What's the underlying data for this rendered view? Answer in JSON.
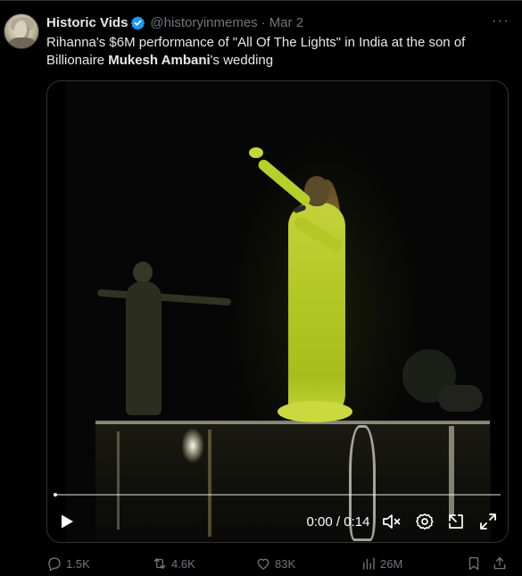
{
  "tweet": {
    "display_name": "Historic Vids",
    "handle": "@historyinmemes",
    "separator": "·",
    "date": "Mar 2",
    "more_label": "···",
    "text_before": "Rihanna's $6M performance of \"All Of The Lights\" in India at the son of Billionaire ",
    "text_bold": "Mukesh Ambani",
    "text_after": "'s wedding"
  },
  "video": {
    "time_display": "0:00 / 0:14",
    "progress": 0,
    "icons": [
      "play-icon",
      "mute-icon",
      "settings-icon",
      "dock-icon",
      "fullscreen-icon"
    ]
  },
  "actions": {
    "replies": "1.5K",
    "retweets": "4.6K",
    "likes": "83K",
    "views": "26M"
  },
  "colors": {
    "background": "#000000",
    "text": "#e7e9ea",
    "muted": "#71767b",
    "verified": "#1d9bf0",
    "border": "#2f3336"
  }
}
